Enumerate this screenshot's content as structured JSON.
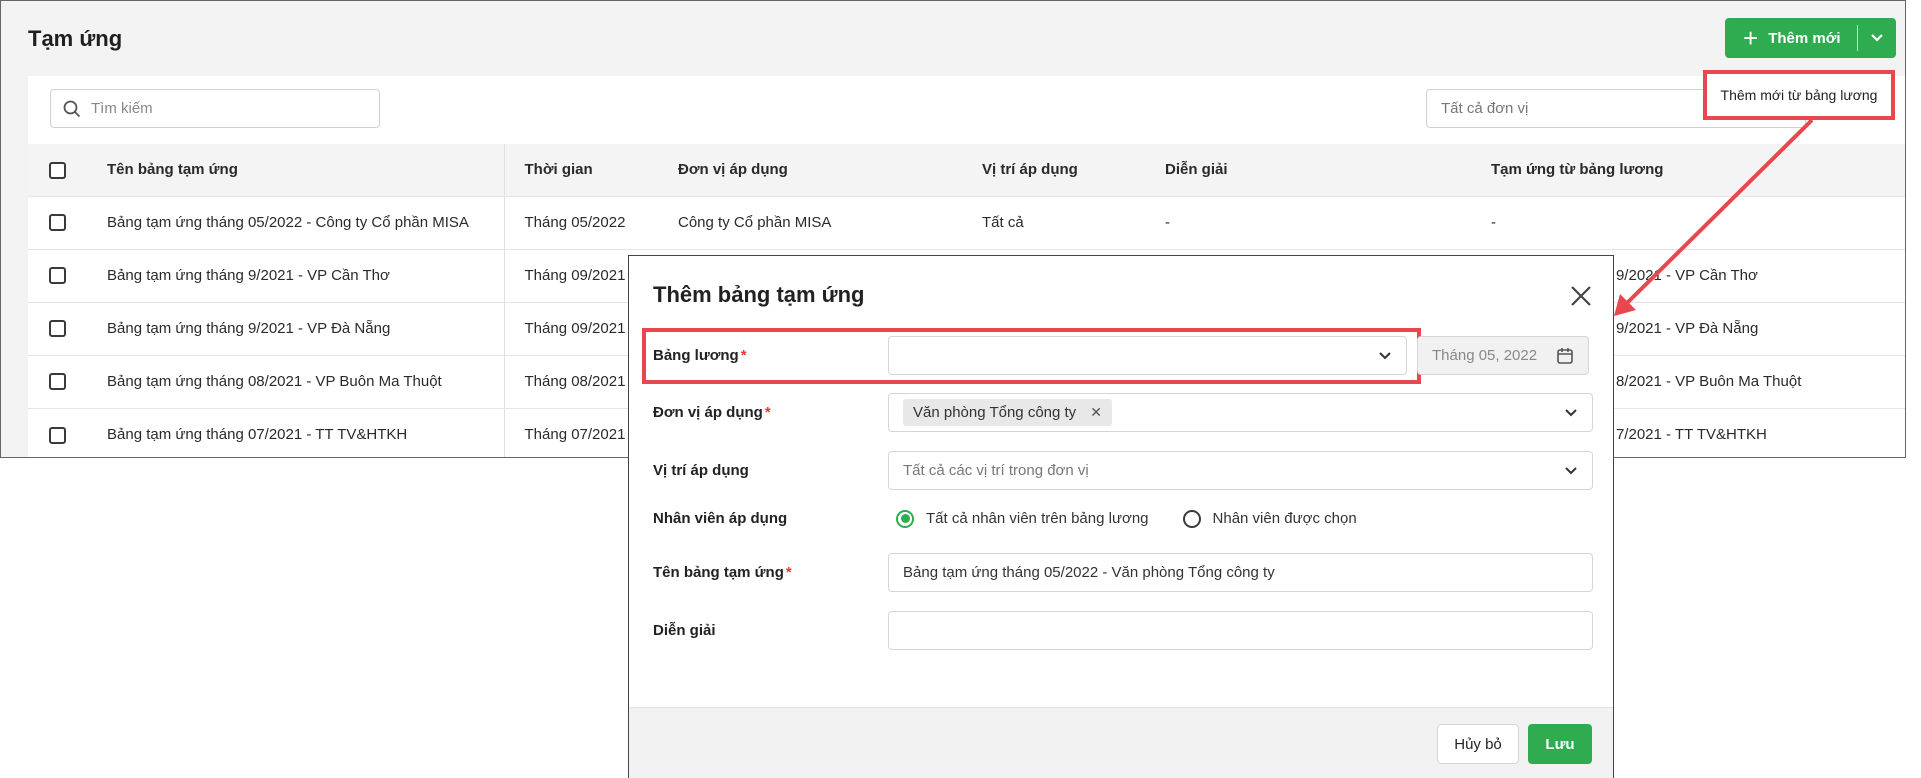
{
  "page": {
    "title": "Tạm ứng"
  },
  "toolbar": {
    "add_label": "Thêm mới",
    "add_menu_item": "Thêm mới từ bảng lương"
  },
  "filters": {
    "search_placeholder": "Tìm kiếm",
    "unit_placeholder": "Tất cả đơn vị"
  },
  "table": {
    "headers": [
      "Tên bảng tạm ứng",
      "Thời gian",
      "Đơn vị áp dụng",
      "Vị trí áp dụng",
      "Diễn giải",
      "Tạm ứng từ bảng lương"
    ],
    "rows": [
      [
        "Bảng tạm ứng tháng 05/2022 - Công ty Cổ phần MISA",
        "Tháng 05/2022",
        "Công ty Cổ phần MISA",
        "Tất cả",
        "-",
        "-"
      ],
      [
        "Bảng tạm ứng tháng 9/2021 - VP Cần Thơ",
        "Tháng 09/2021",
        "",
        "",
        "",
        "Bảng lương tháng 9/2021 - VP Cần Thơ"
      ],
      [
        "Bảng tạm ứng tháng 9/2021 - VP Đà Nẵng",
        "Tháng 09/2021",
        "",
        "",
        "",
        "Bảng lương tháng 9/2021 - VP Đà Nẵng"
      ],
      [
        "Bảng tạm ứng tháng 08/2021 - VP Buôn Ma Thuột",
        "Tháng 08/2021",
        "",
        "",
        "",
        "Bảng lương tháng 8/2021 - VP Buôn Ma Thuột"
      ],
      [
        "Bảng tạm ứng tháng 07/2021 - TT TV&HTKH",
        "Tháng 07/2021",
        "",
        "",
        "",
        "Bảng lương tháng 7/2021 - TT TV&HTKH"
      ]
    ]
  },
  "modal": {
    "title": "Thêm bảng tạm ứng",
    "payroll_label": "Bảng lương",
    "payroll_value": "",
    "date_value": "Tháng 05, 2022",
    "unit_label": "Đơn vị áp dụng",
    "unit_chip": "Văn phòng Tổng công ty",
    "position_label": "Vị trí áp dụng",
    "position_placeholder": "Tất cả các vị trí trong đơn vị",
    "employee_label": "Nhân viên áp dụng",
    "employee_opt_all": "Tất cả nhân viên trên bảng lương",
    "employee_opt_selected": "Nhân viên được chọn",
    "name_label": "Tên bảng tạm ứng",
    "name_value": "Bảng tạm ứng tháng 05/2022 - Văn phòng Tổng công ty",
    "desc_label": "Diễn giải",
    "desc_value": "",
    "cancel_label": "Hủy bỏ",
    "save_label": "Lưu",
    "required_mark": "*"
  },
  "colors": {
    "accent": "#2fac4f",
    "highlight": "#e8474d",
    "required": "#e53935"
  }
}
